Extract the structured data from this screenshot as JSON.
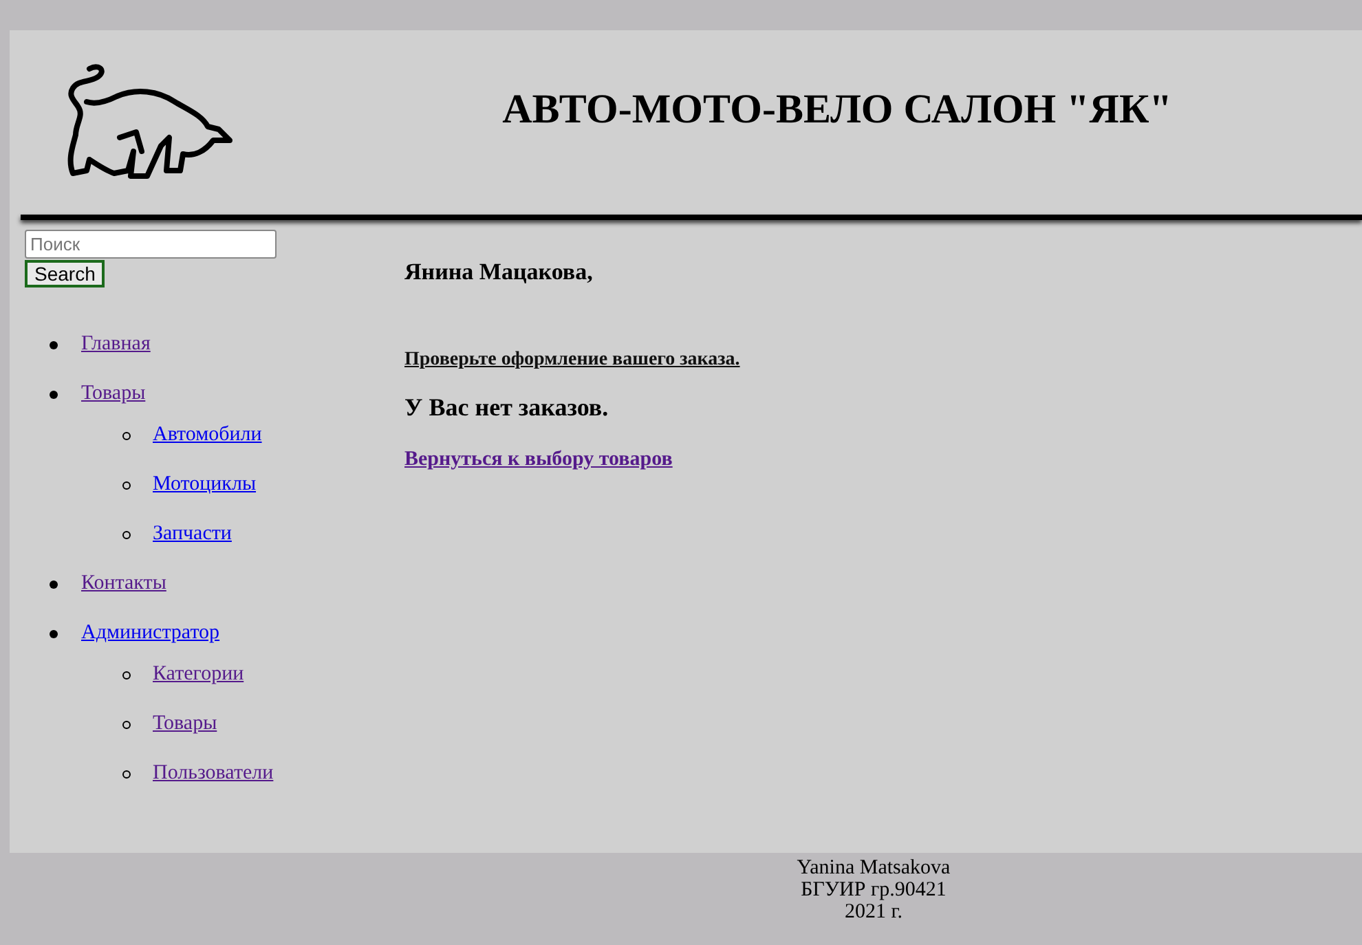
{
  "header": {
    "title": "АВТО-МОТО-ВЕЛО САЛОН \"ЯК\""
  },
  "search": {
    "placeholder": "Поиск",
    "button": "Search"
  },
  "nav": [
    {
      "label": "Главная",
      "visited": true
    },
    {
      "label": "Товары",
      "visited": true,
      "children": [
        {
          "label": "Автомобили",
          "visited": false
        },
        {
          "label": "Мотоциклы",
          "visited": false
        },
        {
          "label": "Запчасти",
          "visited": false
        }
      ]
    },
    {
      "label": "Контакты",
      "visited": true
    },
    {
      "label": "Администратор",
      "visited": false,
      "children": [
        {
          "label": "Категории",
          "visited": true
        },
        {
          "label": "Товары",
          "visited": true
        },
        {
          "label": "Пользователи",
          "visited": true
        }
      ]
    }
  ],
  "content": {
    "greeting": "Янина Мацакова,",
    "check_link": "Проверьте оформление вашего заказа.",
    "message": "У Вас нет заказов.",
    "back_link": "Вернуться к выбору товаров",
    "back_link_visited": true
  },
  "footer": {
    "lines": [
      "Yanina Matsakova",
      "БГУИР гр.90421",
      "2021 г."
    ]
  }
}
